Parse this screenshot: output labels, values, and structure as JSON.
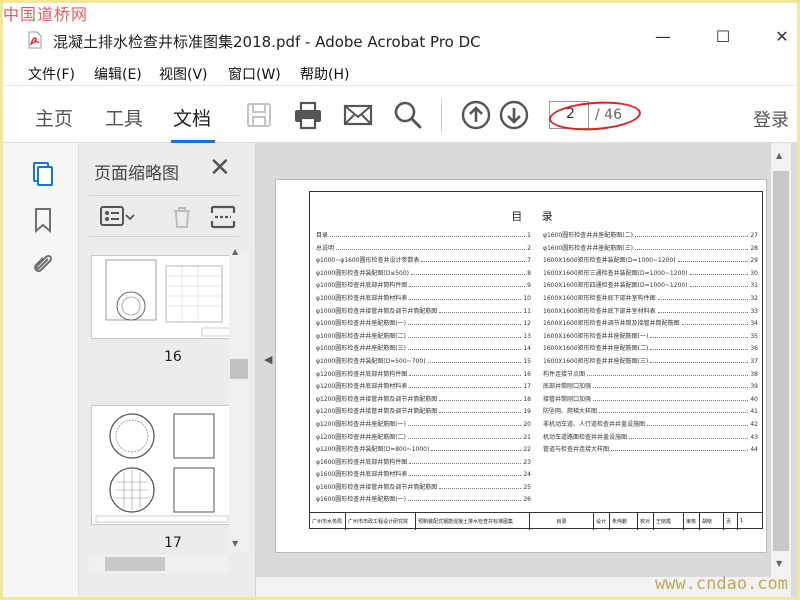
{
  "watermarks": {
    "top": "中国道桥网",
    "bottom": "www.cndao.com"
  },
  "window": {
    "title": "混凝土排水检查井标准图集2018.pdf - Adobe Acrobat Pro DC",
    "minimize": "—",
    "maximize": "☐",
    "close": "✕"
  },
  "menu": {
    "items": [
      "文件(F)",
      "编辑(E)",
      "视图(V)",
      "窗口(W)",
      "帮助(H)"
    ]
  },
  "toolbar": {
    "tabs": [
      "主页",
      "工具",
      "文档"
    ],
    "active_tab": "文档",
    "page_current": "2",
    "page_total": "/ 46",
    "login": "登录"
  },
  "thumbnails": {
    "title": "页面缩略图",
    "close": "✕",
    "pages": [
      "16",
      "17"
    ]
  },
  "toc": {
    "title": "目 录",
    "left": [
      {
        "t": "目录",
        "n": "1"
      },
      {
        "t": "总说明",
        "n": "2"
      },
      {
        "t": "φ1000~φ1600圆形检查井设计参数表",
        "n": "7"
      },
      {
        "t": "φ1000圆形检查井装配图(D≤500)",
        "n": "8"
      },
      {
        "t": "φ1000圆形检查井底部井筒构件图",
        "n": "9"
      },
      {
        "t": "φ1000圆形检查井底部井筒材料表",
        "n": "10"
      },
      {
        "t": "φ1000圆形检查井接管井筒及调节井筒配筋图",
        "n": "11"
      },
      {
        "t": "φ1000圆形检查井井座配筋图(一)",
        "n": "12"
      },
      {
        "t": "φ1000圆形检查井井座配筋图(二)",
        "n": "13"
      },
      {
        "t": "φ1000圆形检查井井座配筋图(三)",
        "n": "14"
      },
      {
        "t": "φ1000圆形检查井装配图(D=500~700)",
        "n": "15"
      },
      {
        "t": "φ1200圆形检查井底部井筒构件图",
        "n": "16"
      },
      {
        "t": "φ1200圆形检查井底部井筒材料表",
        "n": "17"
      },
      {
        "t": "φ1200圆形检查井接管井筒及调节井筒配筋图",
        "n": "18"
      },
      {
        "t": "φ1200圆形检查井接管井筒及调节井筒配筋图",
        "n": "19"
      },
      {
        "t": "φ1200圆形检查井井座配筋图(一)",
        "n": "20"
      },
      {
        "t": "φ1200圆形检查井井座配筋图(二)",
        "n": "21"
      },
      {
        "t": "φ1200圆形检查井装配图(D=800~1000)",
        "n": "22"
      },
      {
        "t": "φ1600圆形检查井底部井筒构件图",
        "n": "23"
      },
      {
        "t": "φ1600圆形检查井底部井筒材料表",
        "n": "24"
      },
      {
        "t": "φ1600圆形检查井接管井筒及调节井筒配筋图",
        "n": "25"
      },
      {
        "t": "φ1600圆形检查井井座配筋图(一)",
        "n": "26"
      }
    ],
    "right": [
      {
        "t": "φ1600圆形检查井井座配筋图(二)",
        "n": "27"
      },
      {
        "t": "φ1600圆形检查井井座配筋图(三)",
        "n": "28"
      },
      {
        "t": "1600X1600矩形检查井装配图(D=1000~1200)",
        "n": "29"
      },
      {
        "t": "1600X1600矩形三通检查井装配图(D=1000~1200)",
        "n": "30"
      },
      {
        "t": "1600X1600矩形四通检查井装配图(D=1000~1200)",
        "n": "31"
      },
      {
        "t": "1600X1600矩形检查井底下部井室构件图",
        "n": "32"
      },
      {
        "t": "1600X1600矩形检查井底下部井室材料表",
        "n": "33"
      },
      {
        "t": "1600X1600矩形检查井调节井筒及接管井筒配筋图",
        "n": "34"
      },
      {
        "t": "1600X1600矩形检查井井座配筋图(一)",
        "n": "35"
      },
      {
        "t": "1600X1600矩形检查井井座配筋图(二)",
        "n": "36"
      },
      {
        "t": "1600X1600矩形检查井井座配筋图(三)",
        "n": "37"
      },
      {
        "t": "构件连接节点图",
        "n": "38"
      },
      {
        "t": "底部井筒刚口加强",
        "n": "39"
      },
      {
        "t": "接管井筒刚口加强",
        "n": "40"
      },
      {
        "t": "防坠网、爬梯大样图",
        "n": "41"
      },
      {
        "t": "非机动车道、人行道检查井井盖设施图",
        "n": "42"
      },
      {
        "t": "机动车道路面检查井井盖设施图",
        "n": "43"
      },
      {
        "t": "管道与检查井连接大样图",
        "n": "44"
      }
    ],
    "title_block": [
      "广州市水务局",
      "广州市市政工程设计研究院",
      "预制装配式钢筋混凝土排水检查井标准图集",
      "目录",
      "设计",
      "朱伟鹏",
      "校对",
      "王晓霞",
      "审核",
      "胡晓",
      "页",
      "1"
    ]
  }
}
